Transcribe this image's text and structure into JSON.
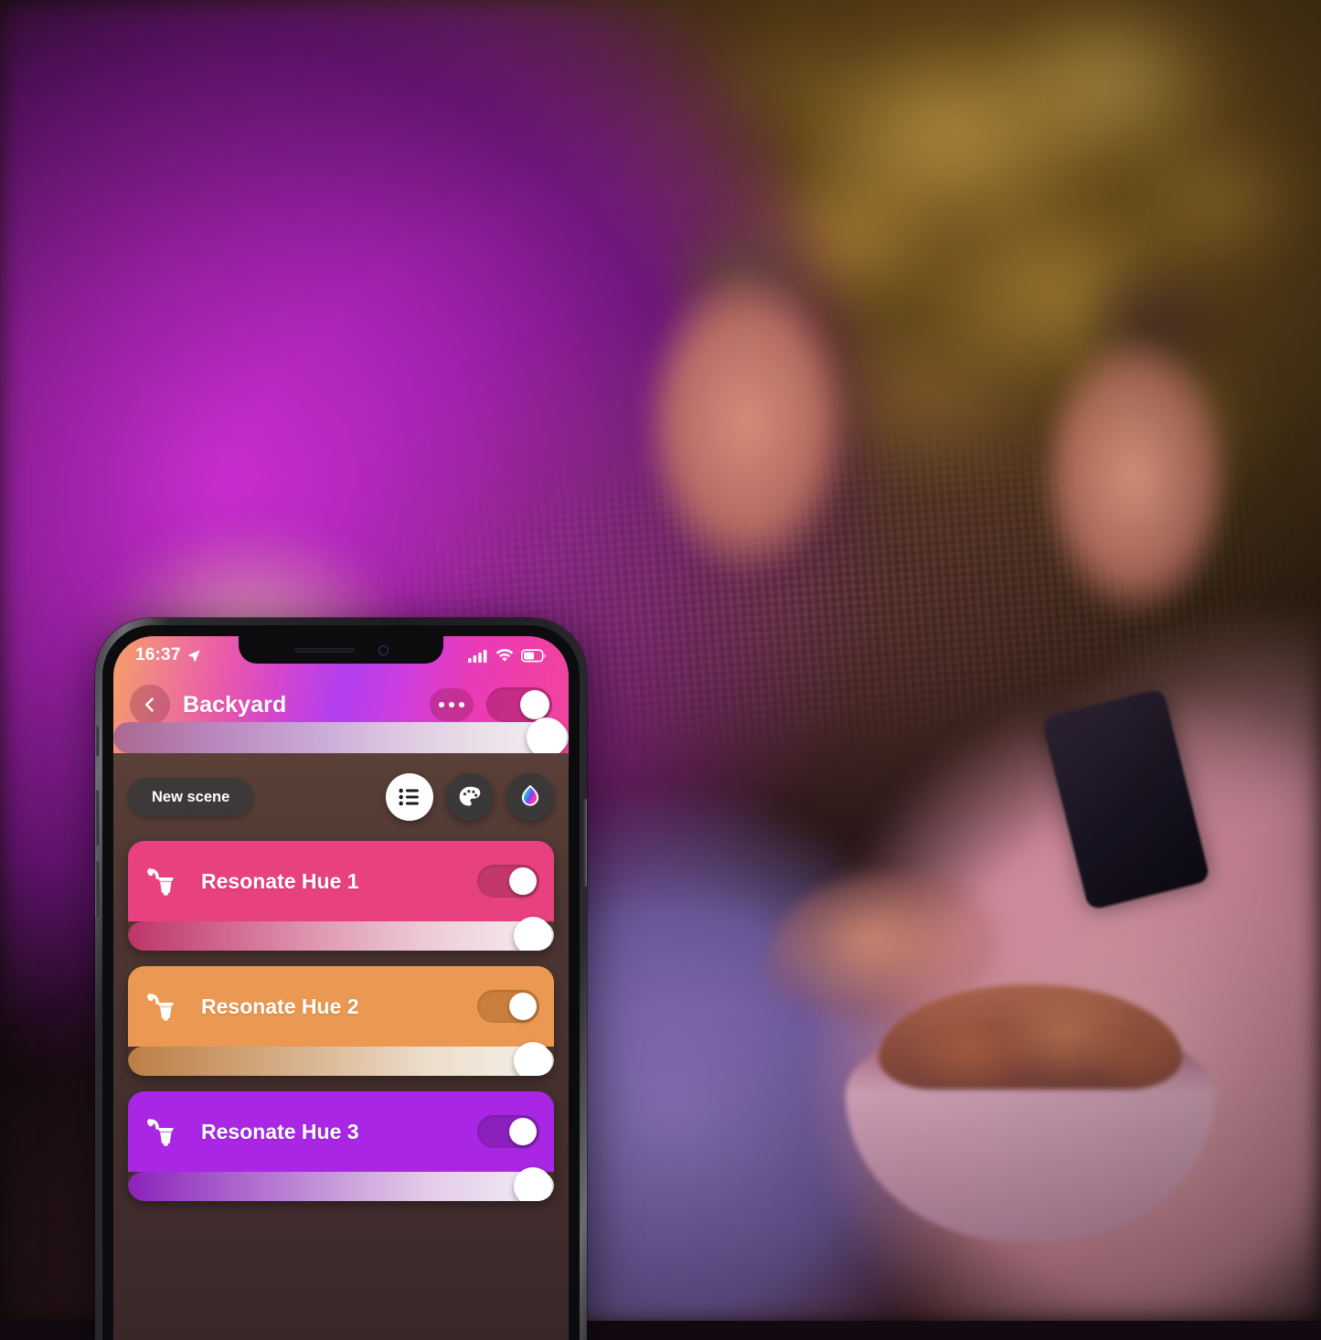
{
  "scene_photo": {
    "description": "Night-time backyard: a couple relaxing on a rattan sofa with a bowl of chips, lit by magenta Hue accent lighting on the wall and warm amber light in the tree behind them."
  },
  "phone": {
    "status_bar": {
      "time": "16:37",
      "location_icon": "location-arrow-icon",
      "cellular_icon": "cellular-signal-icon",
      "wifi_icon": "wifi-icon",
      "battery_icon": "battery-icon"
    },
    "notch": {
      "speaker_icon": "speaker-grille-icon",
      "camera_icon": "front-camera-icon"
    }
  },
  "header": {
    "back_icon": "chevron-left-icon",
    "room_title": "Backyard",
    "more_icon": "overflow-menu-icon",
    "room_toggle": {
      "state": "on"
    },
    "room_brightness": {
      "value": 100
    },
    "gradient": {
      "from": "#f5a065",
      "mid": "#b23ff0",
      "to": "#f0459e"
    }
  },
  "toolbar": {
    "new_scene_label": "New scene",
    "buttons": [
      {
        "name": "list-view-button",
        "icon": "list-icon",
        "active": true
      },
      {
        "name": "scenes-palette-button",
        "icon": "palette-icon",
        "active": false
      },
      {
        "name": "color-picker-button",
        "icon": "hue-color-drop-icon",
        "active": false
      }
    ]
  },
  "lights": [
    {
      "name": "Resonate Hue 1",
      "icon": "wall-lantern-icon",
      "color": "#e8417f",
      "toggle_track": "#c2376c",
      "toggle_state": "on",
      "brightness": 100,
      "slider_from": "#c2376c",
      "slider_to": "#f7f0f2"
    },
    {
      "name": "Resonate Hue 2",
      "icon": "wall-lantern-icon",
      "color": "#ea9852",
      "toggle_track": "#c97e3d",
      "toggle_state": "on",
      "brightness": 100,
      "slider_from": "#c4854a",
      "slider_to": "#f4efe9"
    },
    {
      "name": "Resonate Hue 3",
      "icon": "wall-lantern-icon",
      "color": "#a927e4",
      "toggle_track": "#8b20bd",
      "toggle_state": "on",
      "brightness": 100,
      "slider_from": "#8b20bd",
      "slider_to": "#f4eff6"
    }
  ]
}
